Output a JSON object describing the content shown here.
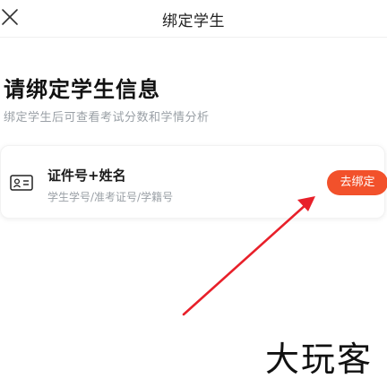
{
  "header": {
    "title": "绑定学生",
    "close_icon": "close-icon"
  },
  "main": {
    "heading": "请绑定学生信息",
    "subtitle": "绑定学生后可查看考试分数和学情分析"
  },
  "card": {
    "icon": "id-card-icon",
    "title": "证件号+姓名",
    "description": "学生学号/准考证号/学籍号",
    "button_label": "去绑定"
  },
  "annotation": {
    "arrow_color": "#e8202a"
  },
  "watermark": {
    "text": "大玩客"
  },
  "colors": {
    "accent": "#f2512b",
    "muted_text": "#9aa0a6"
  }
}
